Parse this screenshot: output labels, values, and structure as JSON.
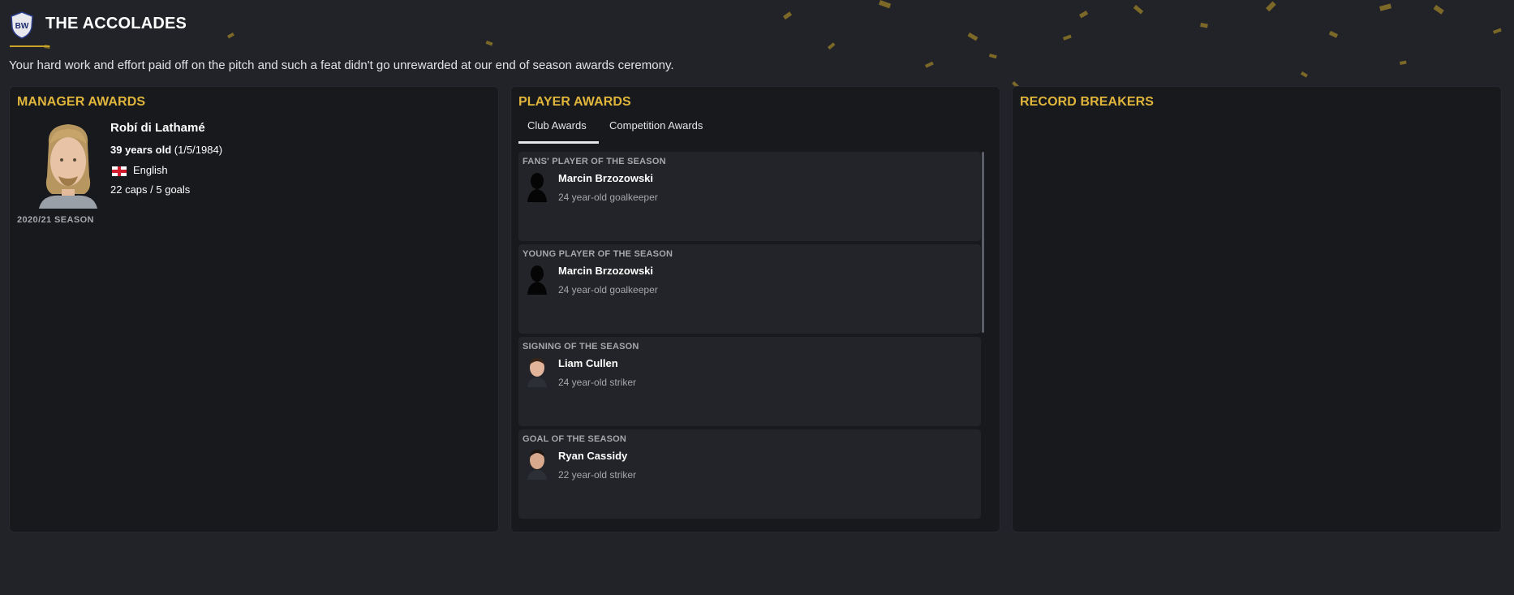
{
  "header": {
    "title": "THE ACCOLADES",
    "subtitle": "Your hard work and effort paid off on the pitch and such a feat didn't go unrewarded at our end of season awards ceremony.",
    "accent_color": "#c9a227"
  },
  "manager_awards": {
    "title": "MANAGER AWARDS",
    "name": "Robí di Lathamé",
    "age_label": "39 years old",
    "dob": "(1/5/1984)",
    "nationality": "English",
    "caps_goals": "22 caps / 5 goals",
    "season": "2020/21 SEASON"
  },
  "player_awards": {
    "title": "PLAYER AWARDS",
    "tabs": [
      {
        "label": "Club Awards",
        "active": true
      },
      {
        "label": "Competition Awards",
        "active": false
      }
    ],
    "awards": [
      {
        "category": "FANS' PLAYER OF THE SEASON",
        "name": "Marcin Brzozowski",
        "desc": "24 year-old goalkeeper",
        "photo": "silhouette"
      },
      {
        "category": "YOUNG PLAYER OF THE SEASON",
        "name": "Marcin Brzozowski",
        "desc": "24 year-old goalkeeper",
        "photo": "silhouette"
      },
      {
        "category": "SIGNING OF THE SEASON",
        "name": "Liam Cullen",
        "desc": "24 year-old striker",
        "photo": "face"
      },
      {
        "category": "GOAL OF THE SEASON",
        "name": "Ryan Cassidy",
        "desc": "22 year-old striker",
        "photo": "face"
      }
    ]
  },
  "record_breakers": {
    "title": "RECORD BREAKERS"
  }
}
